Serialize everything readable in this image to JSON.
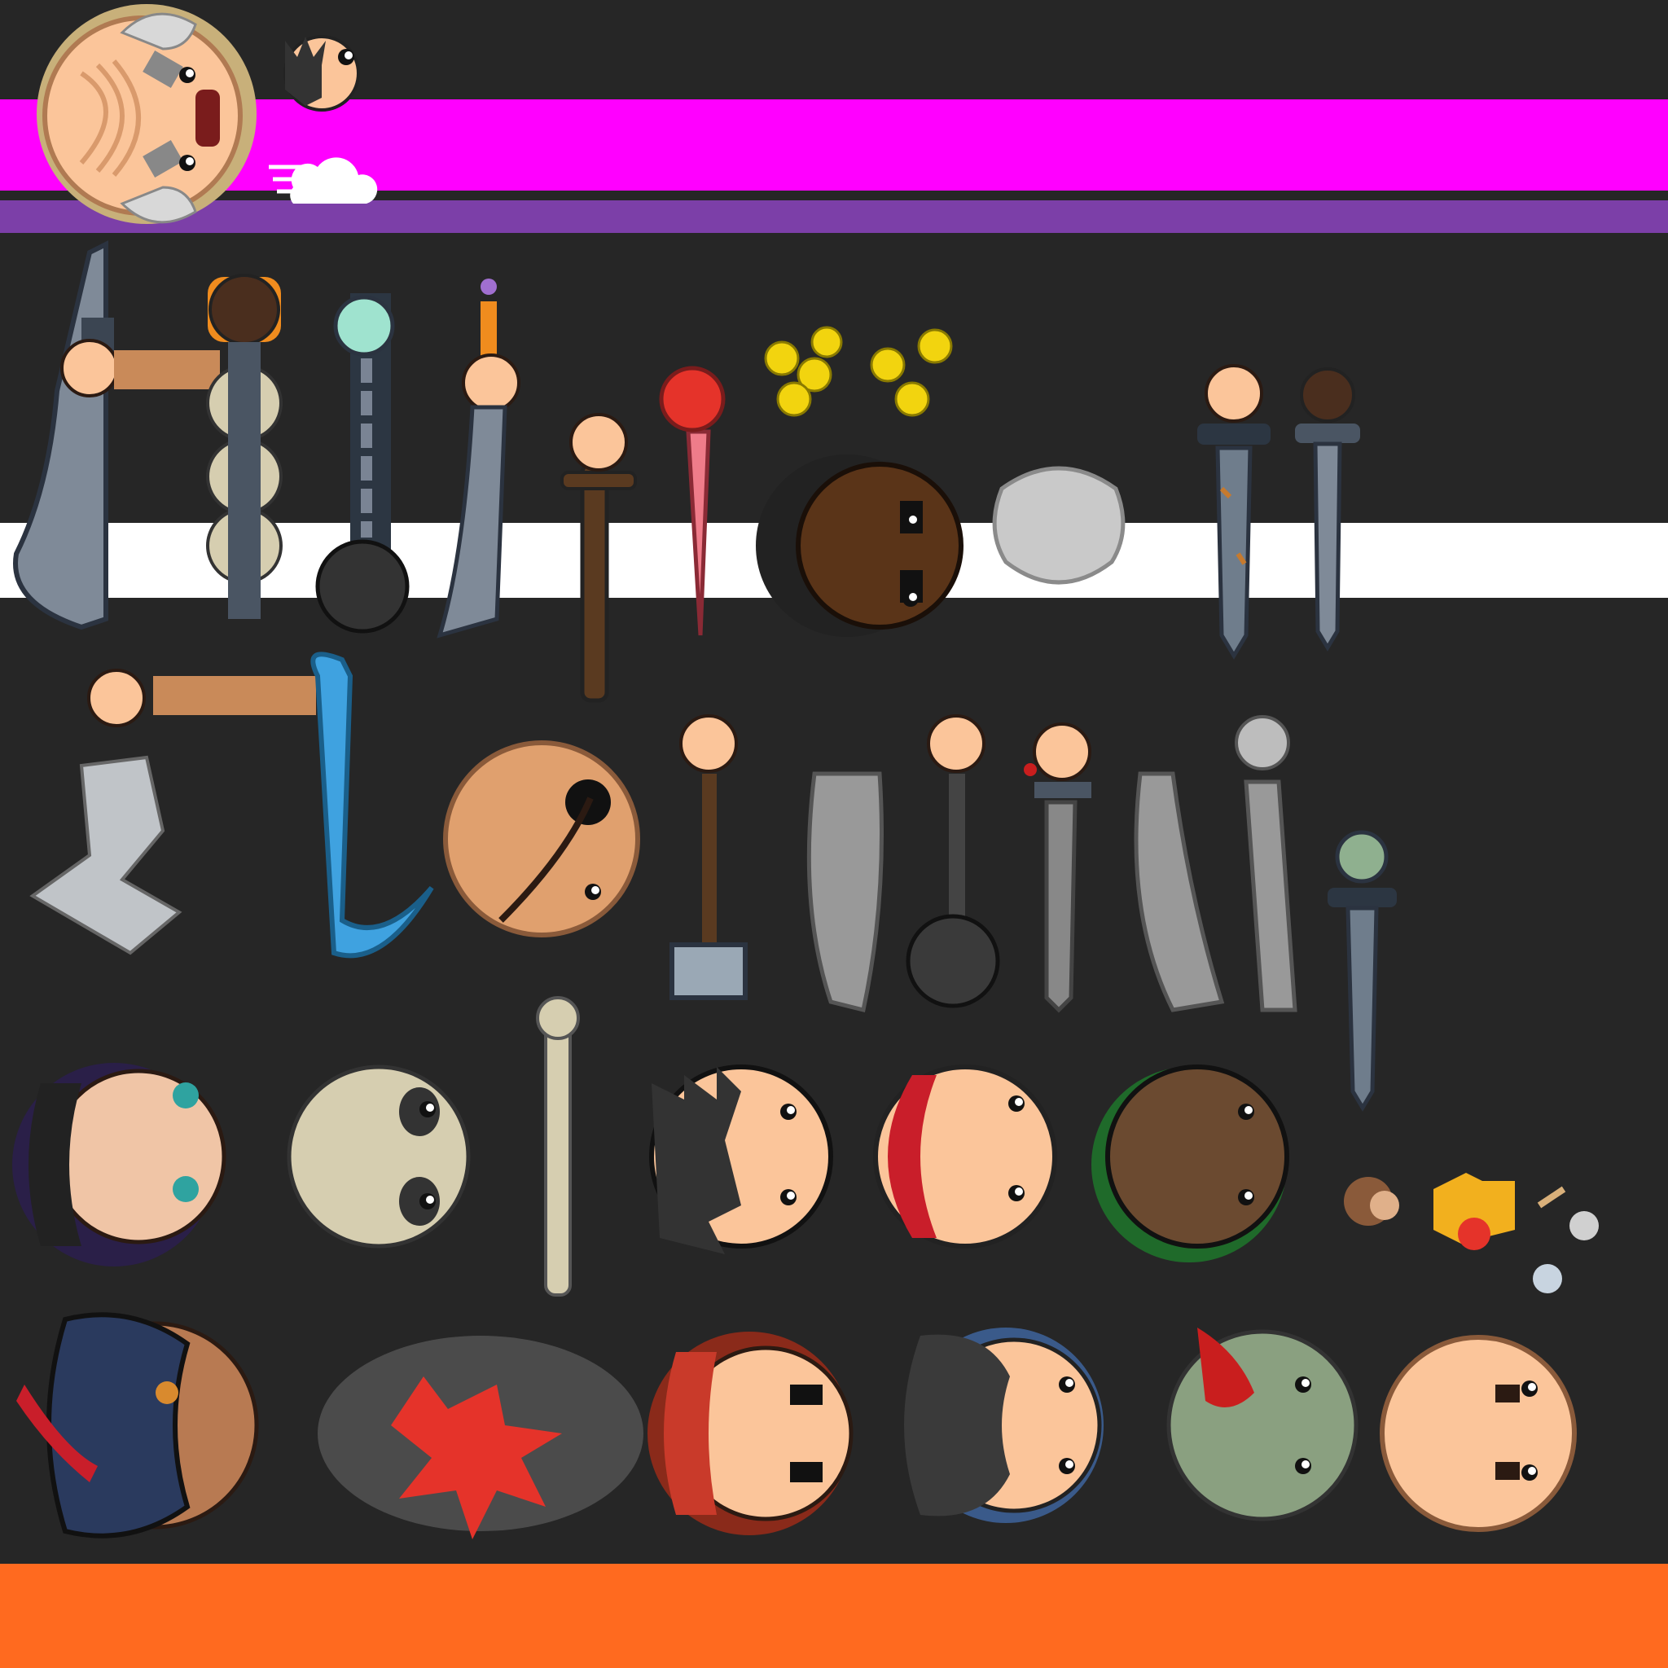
{
  "sheet": {
    "kind": "sprite-atlas",
    "colors": {
      "page": "#262626",
      "magenta_band": "#ff00ff",
      "purple_band": "#7c3fa8",
      "white_band": "#ffffff",
      "orange_band": "#ff6a1f",
      "skin": "#fbc59a",
      "arm": "#c98a59",
      "steel": "#8f9aa6",
      "gold": "#f2d40f"
    },
    "rows": [
      {
        "name": "row-1",
        "sprites": [
          "old-pirate-head",
          "spiky-hair-head",
          "speed-cloud-icon"
        ]
      },
      {
        "name": "row-2",
        "sprites": [
          "cleaver-weapon",
          "skull-flail-weapon",
          "chain-ball-weapon",
          "dagger-weapon",
          "wooden-mace-weapon",
          "crab-claw-sword-weapon",
          "gold-coins",
          "afro-pirate-head",
          "stone-troll-mask",
          "rusty-sword-weapon",
          "steel-sword-weapon"
        ]
      },
      {
        "name": "row-3",
        "sprites": [
          "ice-shard-axe-weapon",
          "water-cutlass-weapon",
          "eyepatch-bald-head",
          "hammer-weapon",
          "scimitar-weapon",
          "ball-mace-weapon",
          "jeweled-sword-weapon",
          "curved-blade-weapon",
          "long-blade-weapon",
          "jade-sword-weapon"
        ]
      },
      {
        "name": "row-4",
        "sprites": [
          "witch-head",
          "skeleton-head",
          "bone-club-weapon",
          "dark-hair-head",
          "red-bandana-head",
          "tattooed-head",
          "monkey-pet",
          "fire-spirit",
          "shells"
        ]
      },
      {
        "name": "row-5",
        "sprites": [
          "captain-head",
          "blood-splat-smoke",
          "dreadlock-pirate-head",
          "beret-officer-head",
          "zombie-head",
          "bald-gentleman-head"
        ]
      }
    ]
  }
}
